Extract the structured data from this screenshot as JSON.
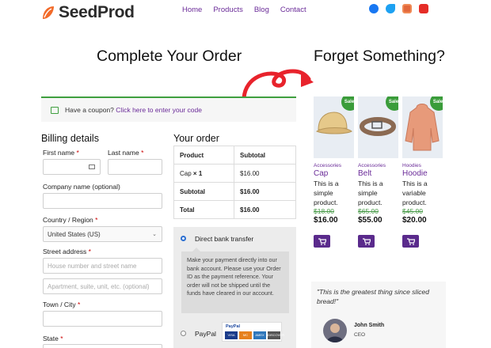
{
  "header": {
    "logo_text": "SeedProd",
    "nav": [
      "Home",
      "Products",
      "Blog",
      "Contact"
    ],
    "social_icons": [
      "facebook-icon",
      "twitter-icon",
      "instagram-icon",
      "youtube-icon"
    ],
    "colors": {
      "brand_purple": "#6a2b98",
      "accent_orange": "#f26b2a"
    }
  },
  "checkout": {
    "title": "Complete Your Order",
    "coupon_prefix": "Have a coupon?",
    "coupon_link": "Click here to enter your code",
    "billing_title": "Billing details",
    "first_name_label": "First name",
    "last_name_label": "Last name",
    "company_label": "Company name (optional)",
    "country_label": "Country / Region",
    "country_value": "United States (US)",
    "street_label": "Street address",
    "street_placeholder": "House number and street name",
    "street2_placeholder": "Apartment, suite, unit, etc. (optional)",
    "town_label": "Town / City",
    "state_label": "State",
    "required_mark": "*"
  },
  "order": {
    "title": "Your order",
    "headers": [
      "Product",
      "Subtotal"
    ],
    "item_name": "Cap",
    "item_qty": "× 1",
    "item_price": "$16.00",
    "subtotal_label": "Subtotal",
    "subtotal_value": "$16.00",
    "total_label": "Total",
    "total_value": "$16.00"
  },
  "payment": {
    "bank_label": "Direct bank transfer",
    "bank_description": "Make your payment directly into our bank account. Please use your Order ID as the payment reference. Your order will not be shipped until the funds have cleared in our account.",
    "paypal_label": "PayPal",
    "paypal_logo_text": "PayPal",
    "card_logos": [
      "VISA",
      "MC",
      "AMEX",
      "DISCOVER"
    ]
  },
  "upsell": {
    "title": "Forget Something?",
    "sale_badge": "Sale!",
    "products": [
      {
        "category": "Accessories",
        "name": "Cap",
        "desc": "This is a simple product.",
        "old_price": "$18.00",
        "price": "$16.00"
      },
      {
        "category": "Accessories",
        "name": "Belt",
        "desc": "This is a simple product.",
        "old_price": "$65.00",
        "price": "$55.00"
      },
      {
        "category": "Hoodies",
        "name": "Hoodie",
        "desc": "This is a variable product.",
        "old_price": "$45.00",
        "price": "$20.00"
      }
    ]
  },
  "testimonial": {
    "quote": "\"This is the greatest thing since sliced bread!\"",
    "author": "John Smith",
    "role": "CEO"
  }
}
